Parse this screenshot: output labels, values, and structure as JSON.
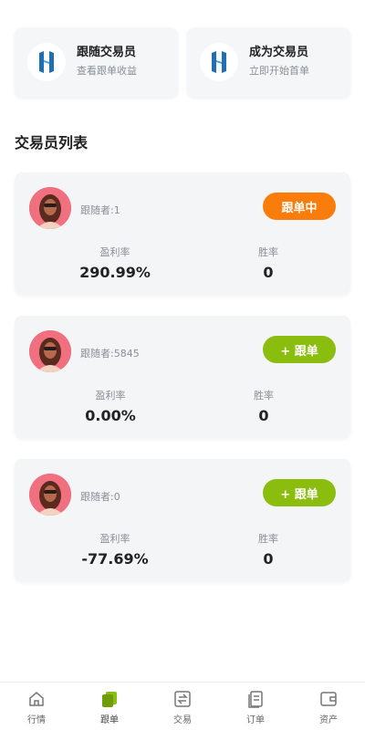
{
  "top_cards": [
    {
      "title": "跟随交易员",
      "subtitle": "查看跟单收益"
    },
    {
      "title": "成为交易员",
      "subtitle": "立即开始首单"
    }
  ],
  "section_title": "交易员列表",
  "traders": [
    {
      "followers": "跟随者:1",
      "button_label": "跟单中",
      "button_state": "following",
      "profit_label": "盈利率",
      "profit_value": "290.99%",
      "winrate_label": "胜率",
      "winrate_value": "0"
    },
    {
      "followers": "跟随者:5845",
      "button_label": "+ 跟单",
      "button_state": "follow",
      "profit_label": "盈利率",
      "profit_value": "0.00%",
      "winrate_label": "胜率",
      "winrate_value": "0"
    },
    {
      "followers": "跟随者:0",
      "button_label": "+ 跟单",
      "button_state": "follow",
      "profit_label": "盈利率",
      "profit_value": "-77.69%",
      "winrate_label": "胜率",
      "winrate_value": "0"
    }
  ],
  "bottom_nav": [
    {
      "label": "行情",
      "icon": "home-icon",
      "active": false
    },
    {
      "label": "跟单",
      "icon": "copy-trade-icon",
      "active": true
    },
    {
      "label": "交易",
      "icon": "exchange-icon",
      "active": false
    },
    {
      "label": "订单",
      "icon": "orders-icon",
      "active": false
    },
    {
      "label": "资产",
      "icon": "wallet-icon",
      "active": false
    }
  ],
  "colors": {
    "accent_green": "#8bbd0f",
    "accent_orange": "#fa7d0c",
    "logo_blue": "#1f6fb5"
  }
}
